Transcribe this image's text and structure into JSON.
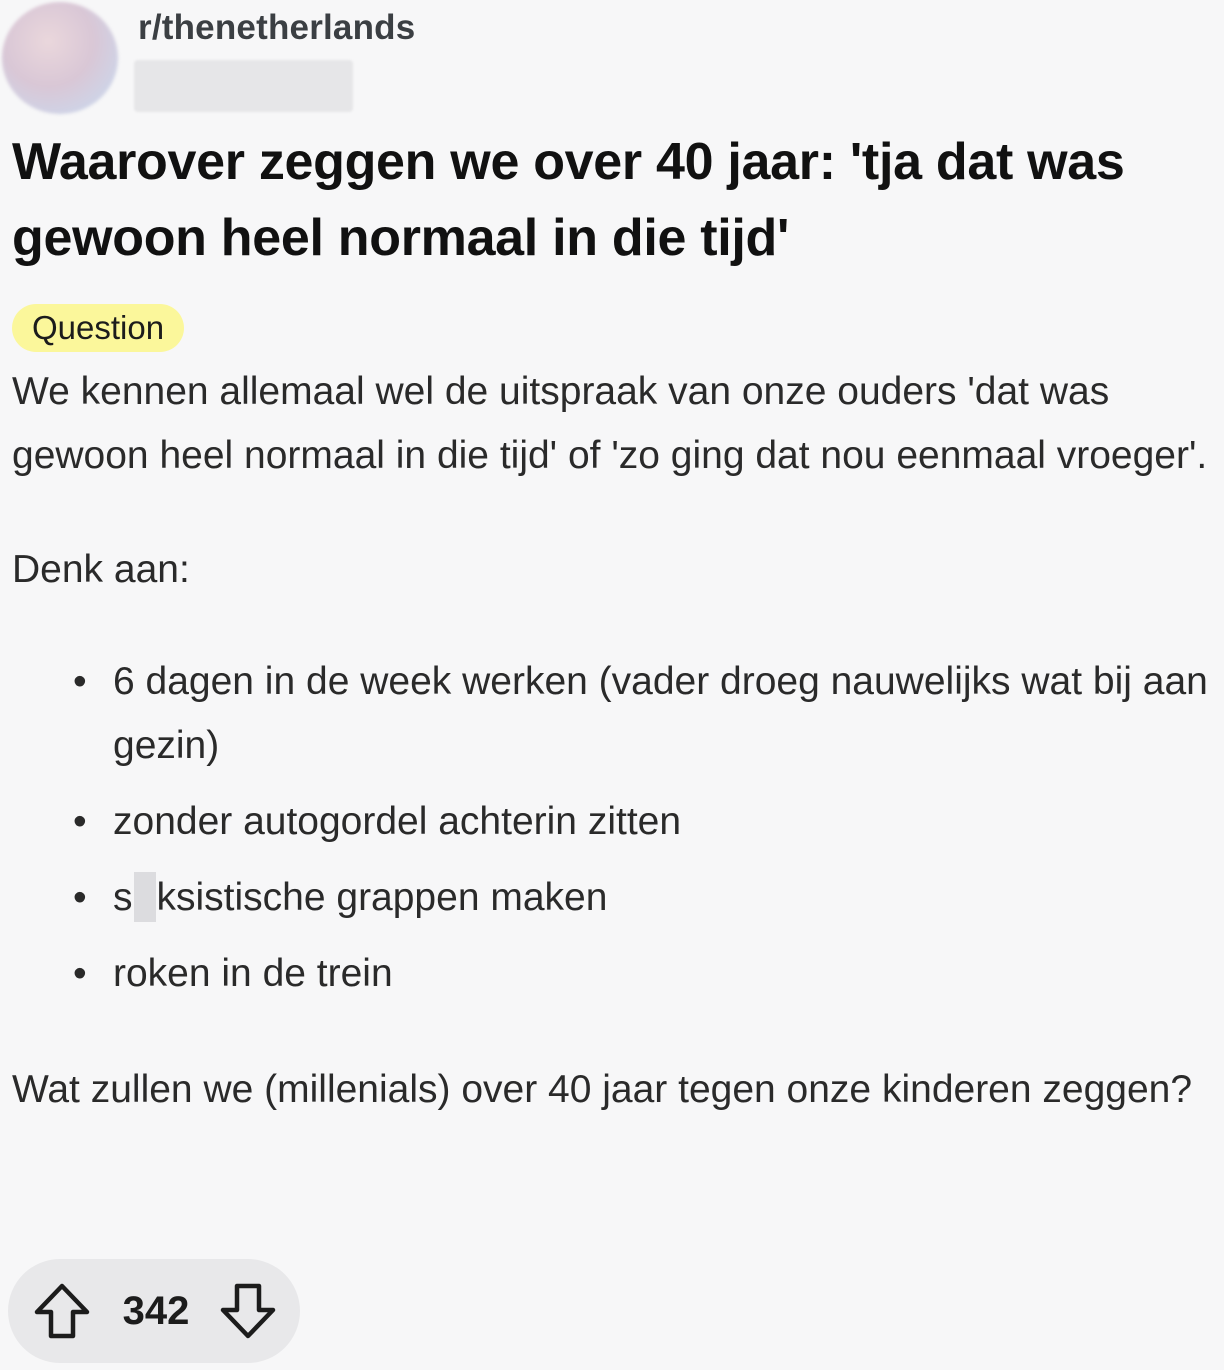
{
  "post": {
    "subreddit": "r/thenetherlands",
    "title": "Waarover zeggen we over 40 jaar: 'tja dat was gewoon heel normaal in die tijd'",
    "flair": "Question",
    "flair_color": "#fbf79b",
    "body": {
      "intro": "We kennen allemaal wel de uitspraak van onze ouders 'dat was gewoon heel normaal in die tijd' of 'zo ging dat nou eenmaal vroeger'.",
      "list_intro": "Denk aan:",
      "items": [
        {
          "text": "6 dagen in de week werken (vader droeg nauwelijks wat bij aan gezin)"
        },
        {
          "text": "zonder autogordel achterin zitten"
        },
        {
          "text_before": "s",
          "text_after": "ksistische grappen maken"
        },
        {
          "text": "roken in de trein"
        }
      ],
      "closing": "Wat zullen we (millenials) over 40 jaar tegen onze kinderen zeggen?"
    },
    "votes": {
      "count": "342",
      "upvote_icon": "arrow-up-outline-icon",
      "downvote_icon": "arrow-down-outline-icon"
    }
  }
}
